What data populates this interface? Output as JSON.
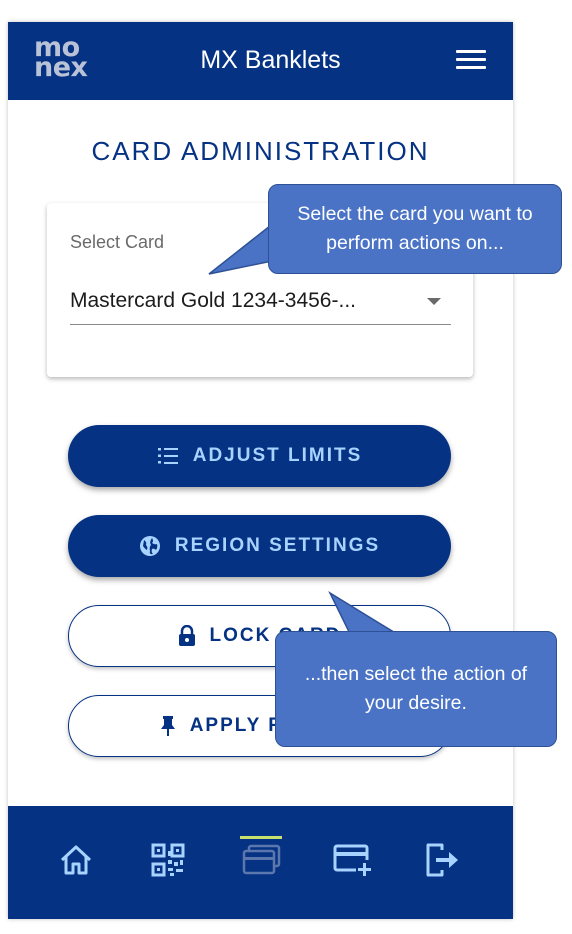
{
  "header": {
    "logo_top": "mo",
    "logo_bottom": "nex",
    "title": "MX Banklets",
    "menu_icon": "hamburger-menu-icon"
  },
  "main": {
    "section_title": "CARD ADMINISTRATION",
    "select": {
      "label": "Select Card",
      "value": "Mastercard Gold 1234-3456-..."
    },
    "buttons": [
      {
        "label": "ADJUST LIMITS",
        "icon": "list-icon",
        "style": "filled"
      },
      {
        "label": "REGION SETTINGS",
        "icon": "globe-icon",
        "style": "filled"
      },
      {
        "label": "LOCK CARD",
        "icon": "lock-icon",
        "style": "outline"
      },
      {
        "label": "APPLY FOR PIN",
        "icon": "pin-icon",
        "style": "outline"
      }
    ]
  },
  "callouts": {
    "top": "Select the card you want to perform actions on...",
    "bottom": "...then select the action of your desire."
  },
  "bottom_nav": {
    "items": [
      "home-icon",
      "qr-code-icon",
      "cards-icon",
      "add-card-icon",
      "logout-icon"
    ],
    "active_index": 2
  },
  "colors": {
    "primary": "#053283",
    "button_text": "#a9d3ff",
    "callout": "#4a73c5",
    "active_indicator": "#c8e06c"
  }
}
